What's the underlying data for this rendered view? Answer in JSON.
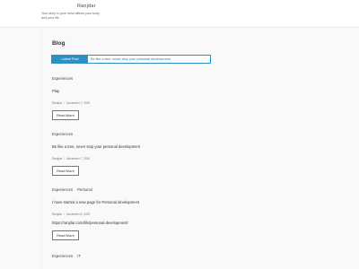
{
  "site": {
    "title": "Ranjdar",
    "tagline": "Your story in your mind affects your body and your life."
  },
  "page": {
    "heading": "Blog"
  },
  "ticker": {
    "label": "Latest Post",
    "text": "Be like a tree, never stop your personal development"
  },
  "posts": [
    {
      "categories": [
        "Experiences"
      ],
      "title": "Play",
      "author": "Ranjdar",
      "date": "November 7, 2020",
      "read_more": "Read More"
    },
    {
      "categories": [
        "Experiences"
      ],
      "title": "Be like a tree, never stop your personal development",
      "author": "Ranjdar",
      "date": "November 7, 2020",
      "read_more": "Read More"
    },
    {
      "categories": [
        "Experiences",
        "Personal"
      ],
      "title": "I have started a new page for Personal development",
      "author": "Ranjdar",
      "date": "November 6, 2020",
      "url": "https://ranjdar.com/life/personal-development/",
      "read_more": "Read More"
    },
    {
      "categories": [
        "Experiences",
        "IT"
      ]
    }
  ],
  "meta_separator": "/"
}
